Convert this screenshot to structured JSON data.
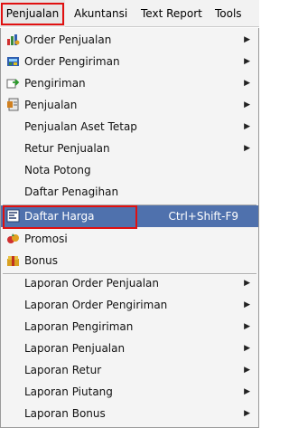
{
  "menubar": {
    "items": [
      "Penjualan",
      "Akuntansi",
      "Text Report",
      "Tools"
    ]
  },
  "menu": {
    "items": [
      {
        "label": "Order Penjualan",
        "icon": "order-sales-icon",
        "submenu": true
      },
      {
        "label": "Order Pengiriman",
        "icon": "order-shipping-icon",
        "submenu": true
      },
      {
        "label": "Pengiriman",
        "icon": "shipping-icon",
        "submenu": true
      },
      {
        "label": "Penjualan",
        "icon": "sales-icon",
        "submenu": true
      },
      {
        "label": "Penjualan Aset Tetap",
        "icon": "",
        "submenu": true
      },
      {
        "label": "Retur Penjualan",
        "icon": "",
        "submenu": true
      },
      {
        "label": "Nota Potong",
        "icon": "",
        "submenu": false
      },
      {
        "label": "Daftar Penagihan",
        "icon": "",
        "submenu": false
      },
      {
        "label": "Daftar Harga",
        "icon": "price-list-icon",
        "submenu": false,
        "shortcut": "Ctrl+Shift-F9",
        "selected": true
      },
      {
        "label": "Promosi",
        "icon": "promotion-icon",
        "submenu": false
      },
      {
        "label": "Bonus",
        "icon": "bonus-icon",
        "submenu": false
      },
      {
        "label": "Laporan Order Penjualan",
        "icon": "",
        "submenu": true
      },
      {
        "label": "Laporan Order Pengiriman",
        "icon": "",
        "submenu": true
      },
      {
        "label": "Laporan Pengiriman",
        "icon": "",
        "submenu": true
      },
      {
        "label": "Laporan Penjualan",
        "icon": "",
        "submenu": true
      },
      {
        "label": "Laporan Retur",
        "icon": "",
        "submenu": true
      },
      {
        "label": "Laporan Piutang",
        "icon": "",
        "submenu": true
      },
      {
        "label": "Laporan Bonus",
        "icon": "",
        "submenu": true
      }
    ]
  },
  "colors": {
    "selected_bg": "#4f71ad",
    "highlight_border": "#e01010",
    "menu_bg": "#f4f4f4"
  }
}
